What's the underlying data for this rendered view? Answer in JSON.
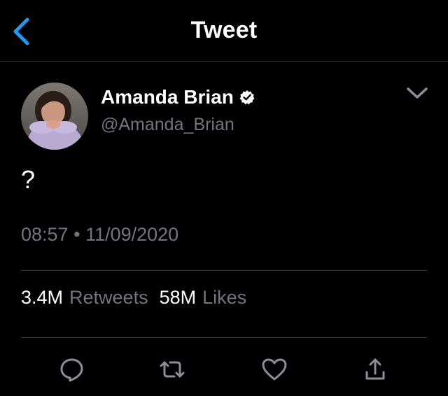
{
  "header": {
    "title": "Tweet",
    "back_icon": "chevron-left-icon"
  },
  "tweet": {
    "author": {
      "display_name": "Amanda Brian",
      "handle": "@Amanda_Brian",
      "verified": true
    },
    "text": "?",
    "time": "08:57",
    "separator": "•",
    "date": "11/09/2020",
    "stats": {
      "retweets_count": "3.4M",
      "retweets_label": "Retweets",
      "likes_count": "58M",
      "likes_label": "Likes"
    }
  },
  "actions": [
    "reply-icon",
    "retweet-icon",
    "like-icon",
    "share-icon"
  ],
  "colors": {
    "background": "#000000",
    "accent": "#1d9bf0",
    "secondary_text": "#71767b",
    "primary_text": "#ffffff",
    "divider": "#3a3d40"
  }
}
